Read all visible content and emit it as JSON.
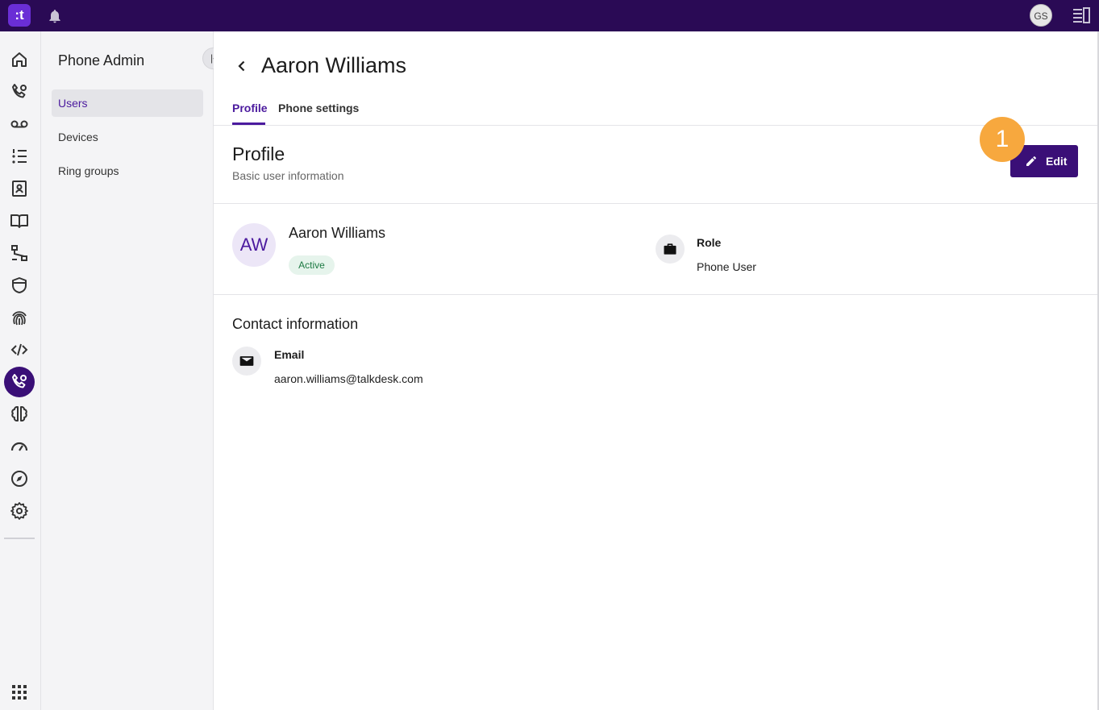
{
  "topbar": {
    "logo_text": ":t",
    "user_initials": "GS"
  },
  "rail": {
    "icons": [
      "home-icon",
      "phone-settings-icon",
      "voicemail-icon",
      "list-icon",
      "contacts-icon",
      "knowledge-icon",
      "flow-icon",
      "shield-icon",
      "fingerprint-icon",
      "code-icon",
      "phone-admin-icon",
      "brain-icon",
      "gauge-icon",
      "compass-icon",
      "gear-icon",
      "apps-grid-icon"
    ],
    "active": "phone-admin-icon"
  },
  "subnav": {
    "title": "Phone Admin",
    "items": [
      {
        "label": "Users",
        "active": true
      },
      {
        "label": "Devices",
        "active": false
      },
      {
        "label": "Ring groups",
        "active": false
      }
    ]
  },
  "page": {
    "title": "Aaron Williams",
    "tabs": [
      {
        "label": "Profile",
        "active": true
      },
      {
        "label": "Phone settings",
        "active": false
      }
    ]
  },
  "profile": {
    "section_title": "Profile",
    "section_subtitle": "Basic user information",
    "edit_label": "Edit",
    "step_number": "1",
    "avatar_initials": "AW",
    "name": "Aaron Williams",
    "status": "Active",
    "role_label": "Role",
    "role_value": "Phone User"
  },
  "contact": {
    "title": "Contact information",
    "email_label": "Email",
    "email_value": "aaron.williams@talkdesk.com"
  },
  "colors": {
    "topbar": "#2a0a55",
    "accent": "#4b1a9e",
    "primary_button": "#3a0f77",
    "step_badge": "#f7a83e",
    "status_active_bg": "#e6f4ec",
    "status_active_text": "#1d7a43"
  }
}
